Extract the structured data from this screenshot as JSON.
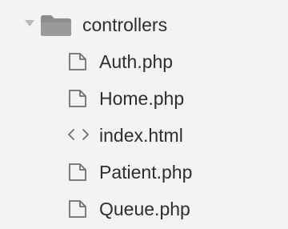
{
  "tree": {
    "folder": {
      "name": "controllers",
      "expanded": true,
      "twisty_icon": "chevron-down-icon",
      "icon": "folder-icon"
    },
    "files": [
      {
        "name": "Auth.php",
        "icon": "file-icon"
      },
      {
        "name": "Home.php",
        "icon": "file-icon"
      },
      {
        "name": "index.html",
        "icon": "code-icon"
      },
      {
        "name": "Patient.php",
        "icon": "file-icon"
      },
      {
        "name": "Queue.php",
        "icon": "file-icon"
      }
    ]
  },
  "colors": {
    "background": "#f3f3f3",
    "text": "#2e2e2e",
    "icon": "#7a7a7a",
    "twisty": "#b0b0b0"
  }
}
